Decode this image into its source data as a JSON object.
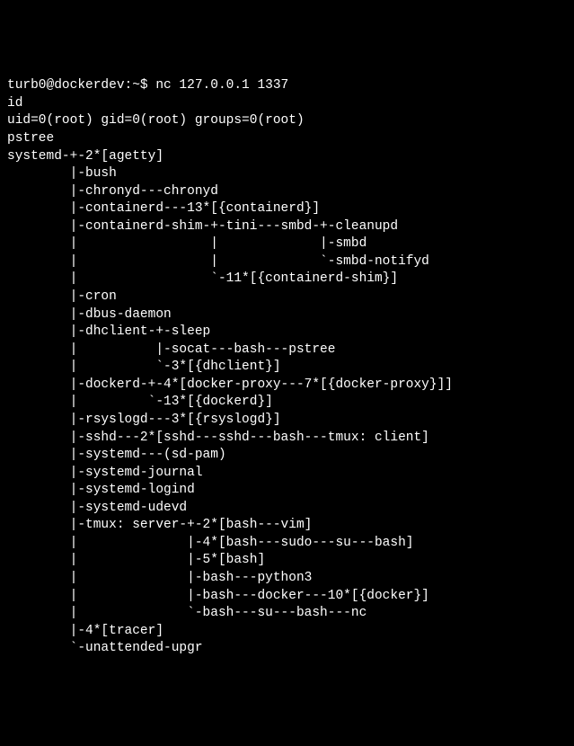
{
  "terminal": {
    "prompt": "turb0@dockerdev:~$ nc 127.0.0.1 1337",
    "lines": [
      "id",
      "uid=0(root) gid=0(root) groups=0(root)",
      "pstree",
      "systemd-+-2*[agetty]",
      "        |-bush",
      "        |-chronyd---chronyd",
      "        |-containerd---13*[{containerd}]",
      "        |-containerd-shim-+-tini---smbd-+-cleanupd",
      "        |                 |             |-smbd",
      "        |                 |             `-smbd-notifyd",
      "        |                 `-11*[{containerd-shim}]",
      "        |-cron",
      "        |-dbus-daemon",
      "        |-dhclient-+-sleep",
      "        |          |-socat---bash---pstree",
      "        |          `-3*[{dhclient}]",
      "        |-dockerd-+-4*[docker-proxy---7*[{docker-proxy}]]",
      "        |         `-13*[{dockerd}]",
      "        |-rsyslogd---3*[{rsyslogd}]",
      "        |-sshd---2*[sshd---sshd---bash---tmux: client]",
      "        |-systemd---(sd-pam)",
      "        |-systemd-journal",
      "        |-systemd-logind",
      "        |-systemd-udevd",
      "        |-tmux: server-+-2*[bash---vim]",
      "        |              |-4*[bash---sudo---su---bash]",
      "        |              |-5*[bash]",
      "        |              |-bash---python3",
      "        |              |-bash---docker---10*[{docker}]",
      "        |              `-bash---su---bash---nc",
      "        |-4*[tracer]",
      "        `-unattended-upgr"
    ]
  }
}
